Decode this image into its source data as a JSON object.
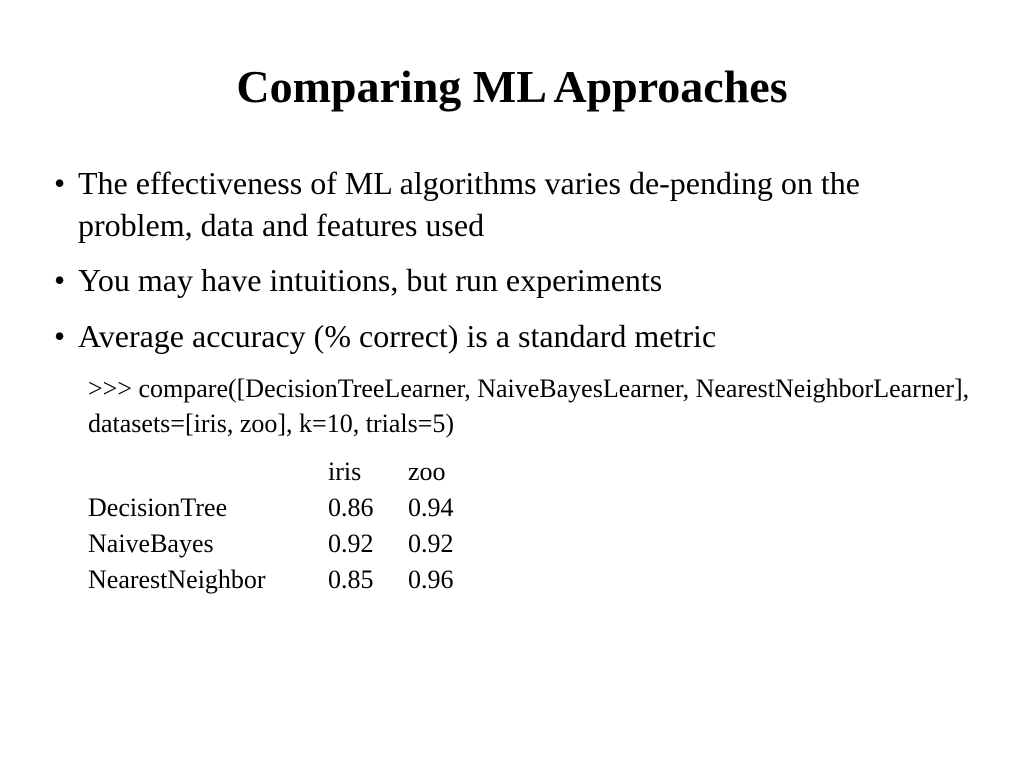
{
  "title": "Comparing ML Approaches",
  "bullets": [
    "The effectiveness of ML algorithms varies de-pending on the problem, data and features used",
    "You may have intuitions, but run experiments",
    "Average accuracy (% correct) is a standard metric"
  ],
  "code": ">>> compare([DecisionTreeLearner, NaiveBayesLearner, NearestNeighborLearner], datasets=[iris, zoo], k=10, trials=5)",
  "table": {
    "columns": [
      "iris",
      "zoo"
    ],
    "rows": [
      {
        "label": "DecisionTree",
        "values": [
          "0.86",
          "0.94"
        ]
      },
      {
        "label": "NaiveBayes",
        "values": [
          "0.92",
          "0.92"
        ]
      },
      {
        "label": "NearestNeighbor",
        "values": [
          "0.85",
          "0.96"
        ]
      }
    ]
  }
}
